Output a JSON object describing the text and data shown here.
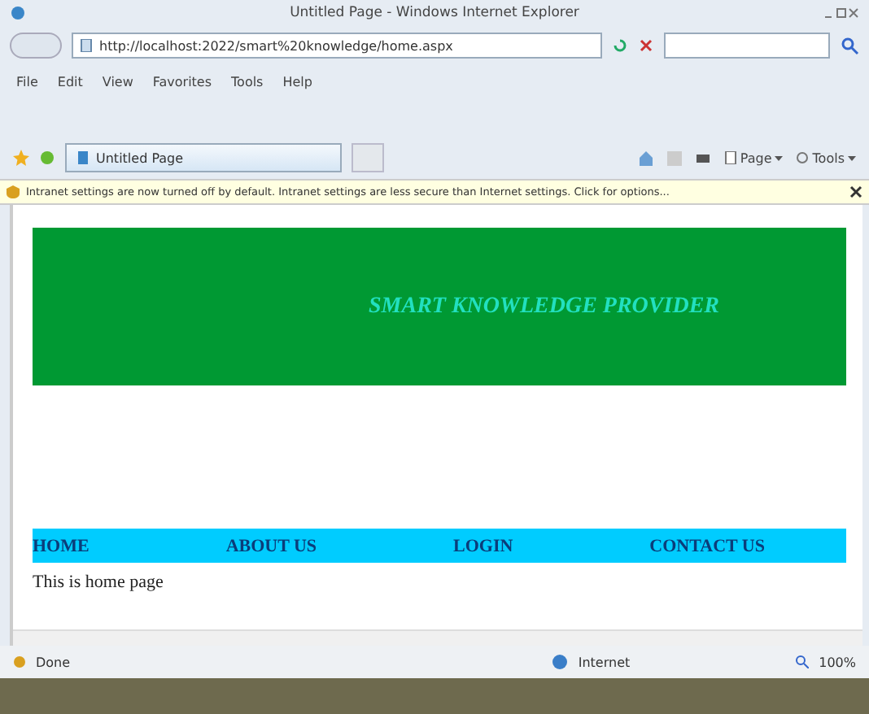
{
  "window": {
    "title": "Untitled Page - Windows Internet Explorer"
  },
  "address_bar": {
    "url": "http://localhost:2022/smart%20knowledge/home.aspx"
  },
  "menu": [
    "File",
    "Edit",
    "View",
    "Favorites",
    "Tools",
    "Help"
  ],
  "tabs": [
    {
      "label": "Untitled Page",
      "selected": true
    }
  ],
  "command_bar": [
    {
      "label": "Page"
    },
    {
      "label": "Tools"
    }
  ],
  "info_bar": {
    "message": "Intranet settings are now turned off by default. Intranet settings are less secure than Internet settings. Click for options..."
  },
  "page": {
    "banner": "SMART KNOWLEDGE PROVIDER",
    "nav": [
      "HOME",
      "ABOUT US",
      "LOGIN",
      "CONTACT US"
    ],
    "body_text": "This is home page"
  },
  "status_bar": {
    "status": "Done",
    "zone": "Internet",
    "zoom": "100%"
  }
}
